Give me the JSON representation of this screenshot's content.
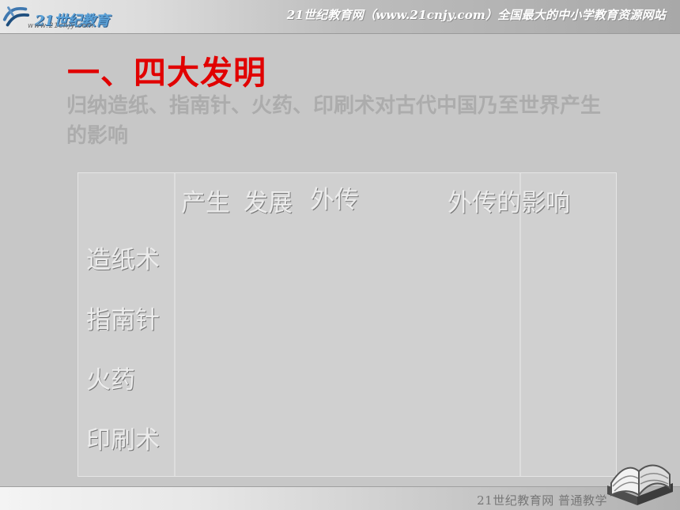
{
  "header": {
    "logo_brand": "21世纪教育",
    "logo_url": "www.21cnjy.com",
    "site_title": "21世纪教育网（www.21cnjy.com）全国最大的中小学教育资源网站"
  },
  "slide": {
    "title": "一、四大发明",
    "ghost_paragraph": "归纳造纸、指南针、火药、印刷术对古代中国乃至世界产生的影响"
  },
  "table": {
    "headers": {
      "col_origin": "产生",
      "col_development": "发展",
      "col_spread": "外传",
      "col_impact": "外传的影响"
    },
    "rows": [
      {
        "label": "造纸术"
      },
      {
        "label": "指南针"
      },
      {
        "label": "火药"
      },
      {
        "label": "印刷术"
      }
    ]
  },
  "footer": {
    "text": "21世纪教育网    普通教学"
  },
  "icons": {
    "header_logo": "swoosh-logo-icon",
    "footer_book": "open-book-icon"
  },
  "colors": {
    "title_red": "#e10000",
    "background_gray": "#c7c7c7",
    "text_white": "#ececec"
  }
}
